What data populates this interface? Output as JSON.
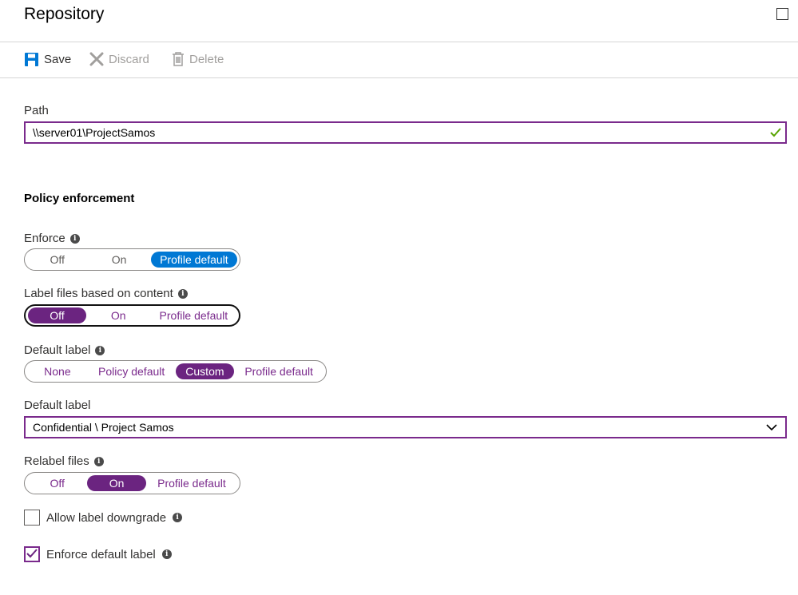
{
  "header": {
    "title": "Repository"
  },
  "toolbar": {
    "save": "Save",
    "discard": "Discard",
    "delete": "Delete"
  },
  "path": {
    "label": "Path",
    "value": "\\\\server01\\ProjectSamos"
  },
  "policy": {
    "section_title": "Policy enforcement",
    "enforce": {
      "label": "Enforce",
      "options": [
        "Off",
        "On",
        "Profile default"
      ],
      "selected": "Profile default"
    },
    "label_files": {
      "label": "Label files based on content",
      "options": [
        "Off",
        "On",
        "Profile default"
      ],
      "selected": "Off"
    },
    "default_label_mode": {
      "label": "Default label",
      "options": [
        "None",
        "Policy default",
        "Custom",
        "Profile default"
      ],
      "selected": "Custom"
    },
    "default_label_select": {
      "label": "Default label",
      "value": "Confidential \\ Project Samos"
    },
    "relabel": {
      "label": "Relabel files",
      "options": [
        "Off",
        "On",
        "Profile default"
      ],
      "selected": "On"
    },
    "allow_downgrade": {
      "label": "Allow label downgrade",
      "checked": false
    },
    "enforce_default": {
      "label": "Enforce default label",
      "checked": true
    }
  },
  "colors": {
    "accent_purple": "#6b2480",
    "accent_blue": "#0078d4",
    "success_green": "#57a300"
  }
}
